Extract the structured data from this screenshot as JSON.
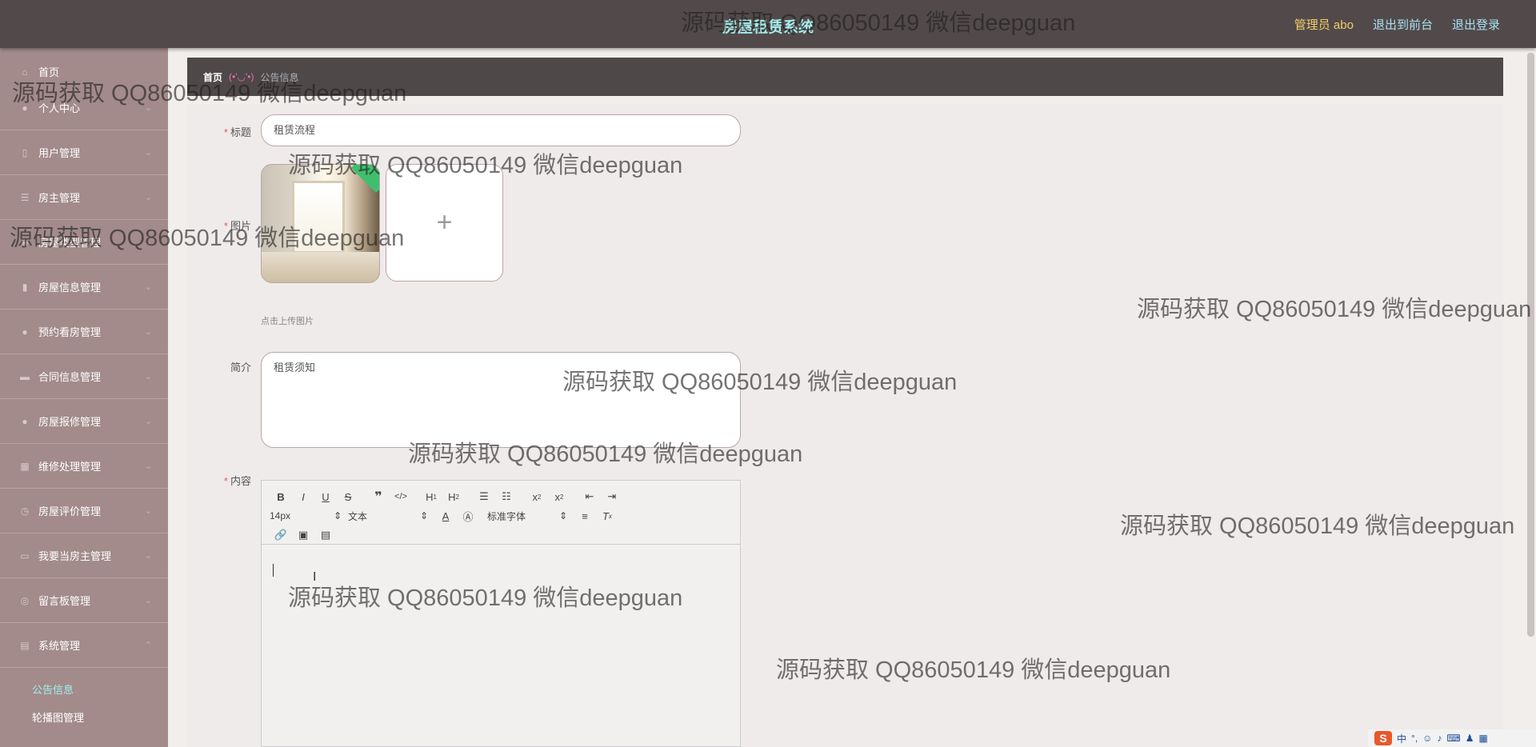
{
  "header": {
    "title": "房屋租赁系统",
    "user": "管理员 abo",
    "links": [
      "退出到前台",
      "退出登录"
    ]
  },
  "sidebar": {
    "items": [
      {
        "label": "首页",
        "icon": "home-icon"
      },
      {
        "label": "个人中心",
        "icon": "user-icon"
      },
      {
        "label": "用户管理",
        "icon": "users-icon"
      },
      {
        "label": "房主管理",
        "icon": "list-icon"
      },
      {
        "label": "房屋类型管理",
        "icon": "tag-icon"
      },
      {
        "label": "房屋信息管理",
        "icon": "chart-icon"
      },
      {
        "label": "预约看房管理",
        "icon": "person-icon"
      },
      {
        "label": "合同信息管理",
        "icon": "document-icon"
      },
      {
        "label": "房屋报修管理",
        "icon": "person-icon"
      },
      {
        "label": "维修处理管理",
        "icon": "grid-icon"
      },
      {
        "label": "房屋评价管理",
        "icon": "clock-icon"
      },
      {
        "label": "我要当房主管理",
        "icon": "card-icon"
      },
      {
        "label": "留言板管理",
        "icon": "chat-icon"
      },
      {
        "label": "系统管理",
        "icon": "settings-icon"
      }
    ],
    "sub_items": [
      "公告信息",
      "轮播图管理"
    ]
  },
  "breadcrumb": {
    "home": "首页",
    "separator": "(•'◡'•)",
    "current": "公告信息"
  },
  "form": {
    "title_label": "标题",
    "title_value": "租赁流程",
    "image_label": "图片",
    "upload_hint": "点击上传图片",
    "intro_label": "简介",
    "intro_value": "租赁须知",
    "content_label": "内容"
  },
  "editor": {
    "font_size": "14px",
    "paragraph": "文本",
    "font_family": "标准字体"
  },
  "watermark": "源码获取 QQ86050149 微信deepguan",
  "tray": {
    "ime": "中"
  },
  "colors": {
    "header_bg": "#524a4a",
    "sidebar_bg": "#a38b8b",
    "title_color": "#a8ecec",
    "admin_color": "#f0cf6b",
    "link_color": "#a8e0ef",
    "active_sub": "#9ff0f0",
    "required": "#e25b5b"
  }
}
